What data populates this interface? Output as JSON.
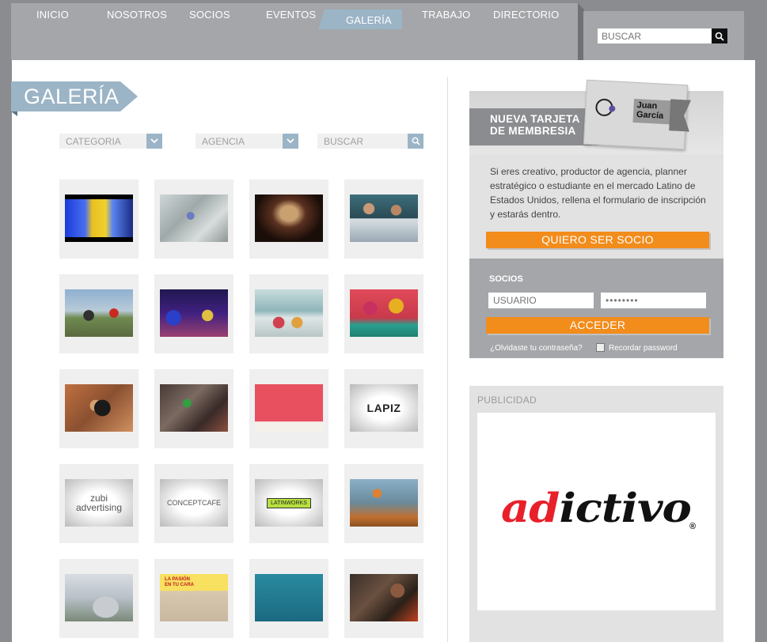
{
  "nav": {
    "items": [
      "INICIO",
      "NOSOTROS",
      "SOCIOS",
      "EVENTOS",
      "GALERÍA",
      "TRABAJO",
      "DIRECTORIO"
    ],
    "active": "GALERÍA",
    "search_placeholder": "BUSCAR"
  },
  "gallery": {
    "title": "GALERÍA",
    "filters": {
      "category_label": "CATEGORIA",
      "agency_label": "AGENCIA",
      "search_placeholder": "BUSCAR"
    },
    "thumbnails": [
      {
        "text": ""
      },
      {
        "text": ""
      },
      {
        "text": ""
      },
      {
        "text": ""
      },
      {
        "text": ""
      },
      {
        "text": ""
      },
      {
        "text": ""
      },
      {
        "text": ""
      },
      {
        "text": ""
      },
      {
        "text": ""
      },
      {
        "text": ""
      },
      {
        "text": "LAPIZ"
      },
      {
        "text": "zubi advertising"
      },
      {
        "text": "CONCEPTCAFE"
      },
      {
        "text": "LATINWORKS"
      },
      {
        "text": ""
      },
      {
        "text": ""
      },
      {
        "text": "LA PASIÓN EN TU CARA"
      },
      {
        "text": ""
      },
      {
        "text": ""
      }
    ]
  },
  "membership": {
    "ribbon_line1": "NUEVA TARJETA",
    "ribbon_line2": "DE MEMBRESIA",
    "card_name_line1": "Juan",
    "card_name_line2": "García",
    "description": "Si eres creativo, productor de agencia, planner estratégico o estudiante en el mercado Latino de Estados Unidos, rellena el formulario de inscripción y estarás dentro.",
    "join_button": "QUIERO SER SOCIO"
  },
  "login": {
    "section_label": "SOCIOS",
    "username_placeholder": "USUARIO",
    "password_value": "••••••••",
    "submit_label": "ACCEDER",
    "forgot_link": "¿Olvidaste tu contraseña?",
    "remember_label": "Recordar password"
  },
  "ads": {
    "label": "PUBLICIDAD",
    "brand_red": "ad",
    "brand_black": "ictivo",
    "reg_mark": "®"
  },
  "colors": {
    "accent_blue": "#9bb4c6",
    "orange": "#f28c1b",
    "frame_gray": "#8a8c8f",
    "brand_red": "#e8202a"
  }
}
